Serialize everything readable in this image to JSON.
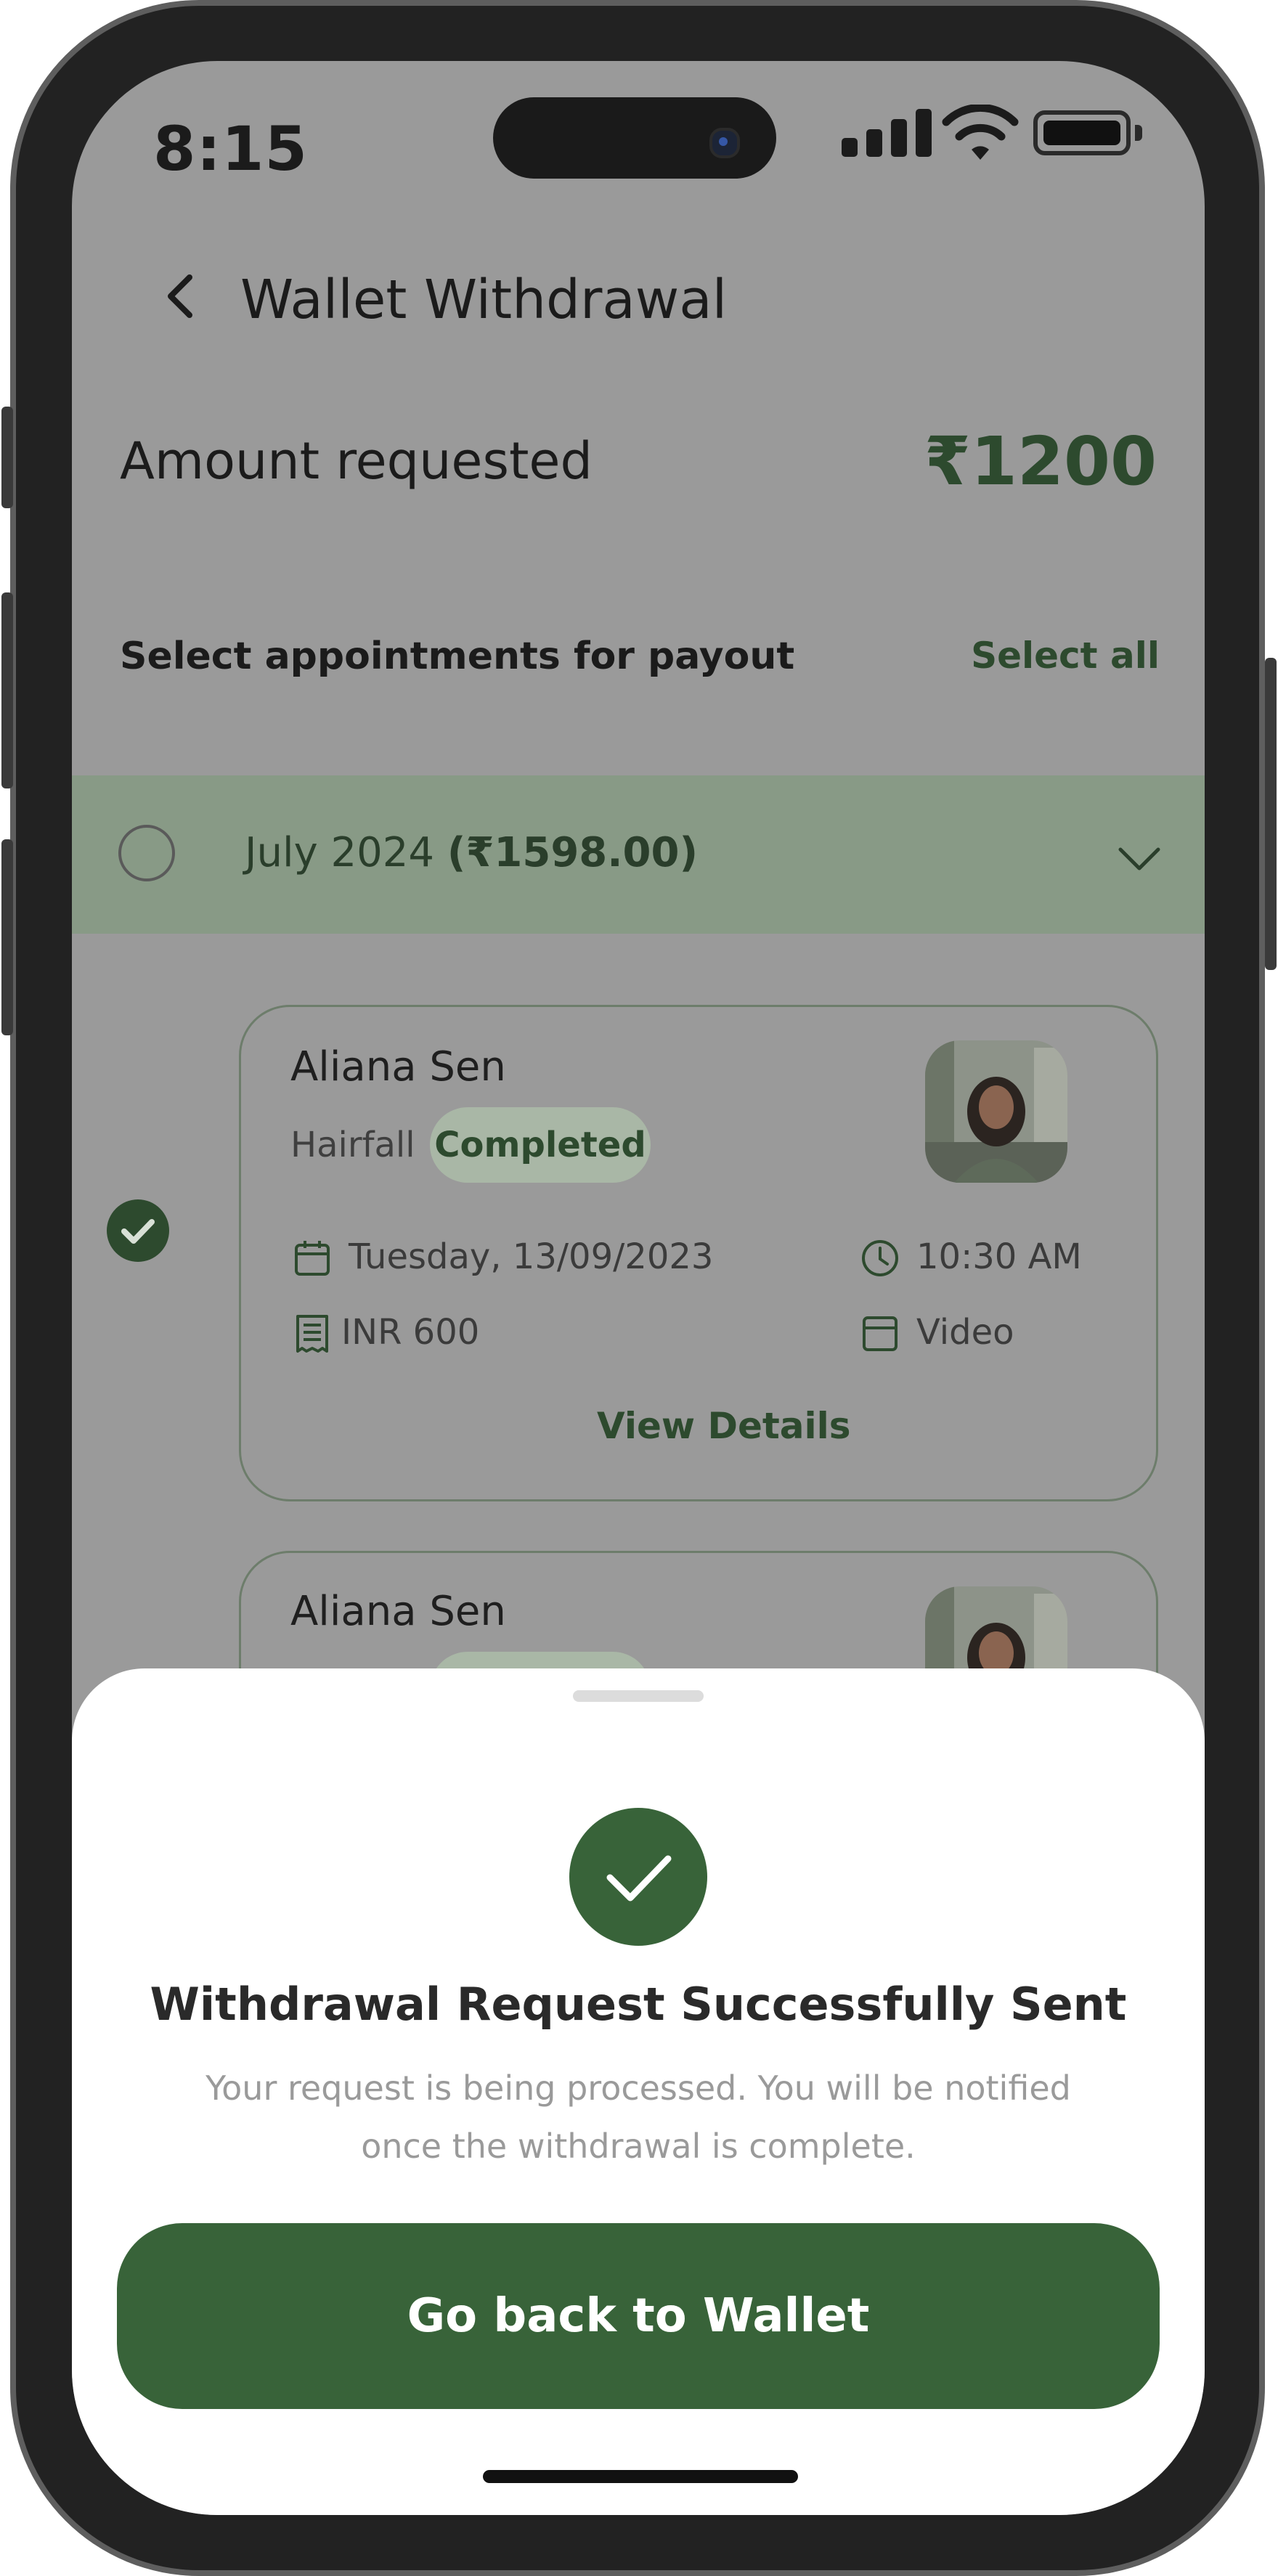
{
  "status_bar": {
    "time": "8:15"
  },
  "header": {
    "title": "Wallet Withdrawal"
  },
  "amount": {
    "label": "Amount requested",
    "value": "₹1200"
  },
  "appointments": {
    "section_label": "Select appointments for payout",
    "select_all_label": "Select all",
    "month_group": {
      "label": "July 2024",
      "total": "(₹1598.00)"
    },
    "items": [
      {
        "patient_name": "Aliana Sen",
        "concern": "Hairfall",
        "status": "Completed",
        "date": "Tuesday, 13/09/2023",
        "time": "10:30 AM",
        "fee": "INR 600",
        "mode": "Video",
        "view_details_label": "View Details",
        "selected": true
      },
      {
        "patient_name": "Aliana Sen"
      }
    ]
  },
  "success_sheet": {
    "title": "Withdrawal Request Successfully Sent",
    "description": "Your request is being processed. You will be notified once the withdrawal is complete.",
    "button_label": "Go back to Wallet"
  },
  "colors": {
    "brand_green": "#386339",
    "text_green": "#2d4a2e",
    "overlay_gray": "#9a9a9a",
    "month_row_bg": "#889a86"
  },
  "icons": {
    "back": "chevron-left-icon",
    "dropdown": "chevron-down-icon",
    "date": "calendar-icon",
    "time": "clock-icon",
    "fee": "receipt-icon",
    "mode": "video-icon",
    "success": "checkmark-icon"
  }
}
